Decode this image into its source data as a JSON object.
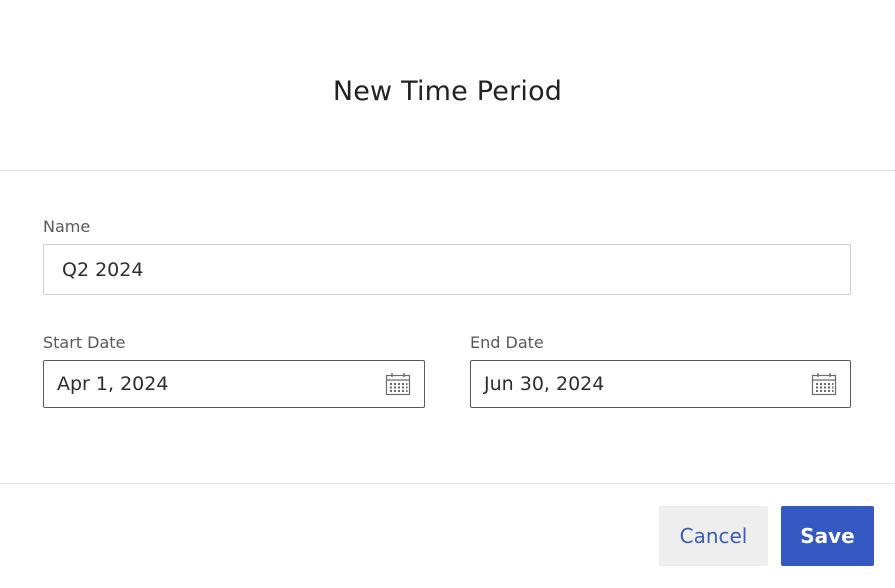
{
  "dialog": {
    "title": "New Time Period"
  },
  "form": {
    "name_label": "Name",
    "name_value": "Q2 2024",
    "start_label": "Start Date",
    "start_value": "Apr 1, 2024",
    "end_label": "End Date",
    "end_value": "Jun 30, 2024"
  },
  "footer": {
    "cancel_label": "Cancel",
    "save_label": "Save"
  },
  "icons": {
    "start_calendar": "calendar-icon",
    "end_calendar": "calendar-icon"
  },
  "colors": {
    "primary": "#3559c2",
    "cancel_text": "#3a5fb5",
    "cancel_bg": "#eeeeee"
  }
}
